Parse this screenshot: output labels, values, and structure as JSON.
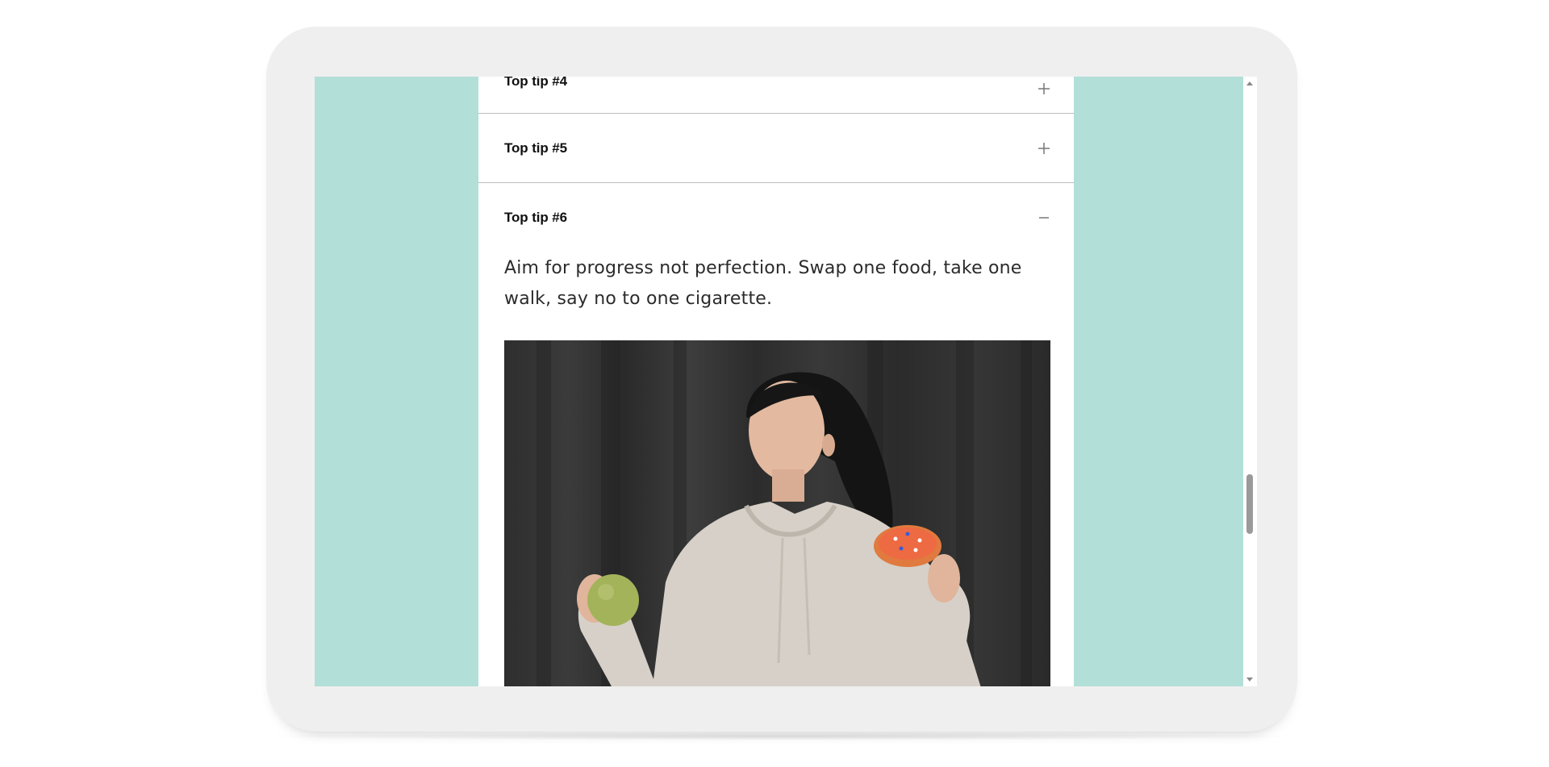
{
  "accordion": {
    "items": [
      {
        "title": "Top tip #4",
        "state": "collapsed"
      },
      {
        "title": "Top tip #5",
        "state": "collapsed"
      },
      {
        "title": "Top tip #6",
        "state": "expanded",
        "body": "Aim for progress not perfection. Swap one food, take one walk, say no to one cigarette."
      }
    ]
  },
  "colors": {
    "page_background": "#b2dfd8",
    "device_frame": "#efefef",
    "content_background": "#ffffff",
    "divider": "#bdbdbd"
  },
  "icons": {
    "collapsed": "plus-icon",
    "expanded": "minus-icon"
  }
}
